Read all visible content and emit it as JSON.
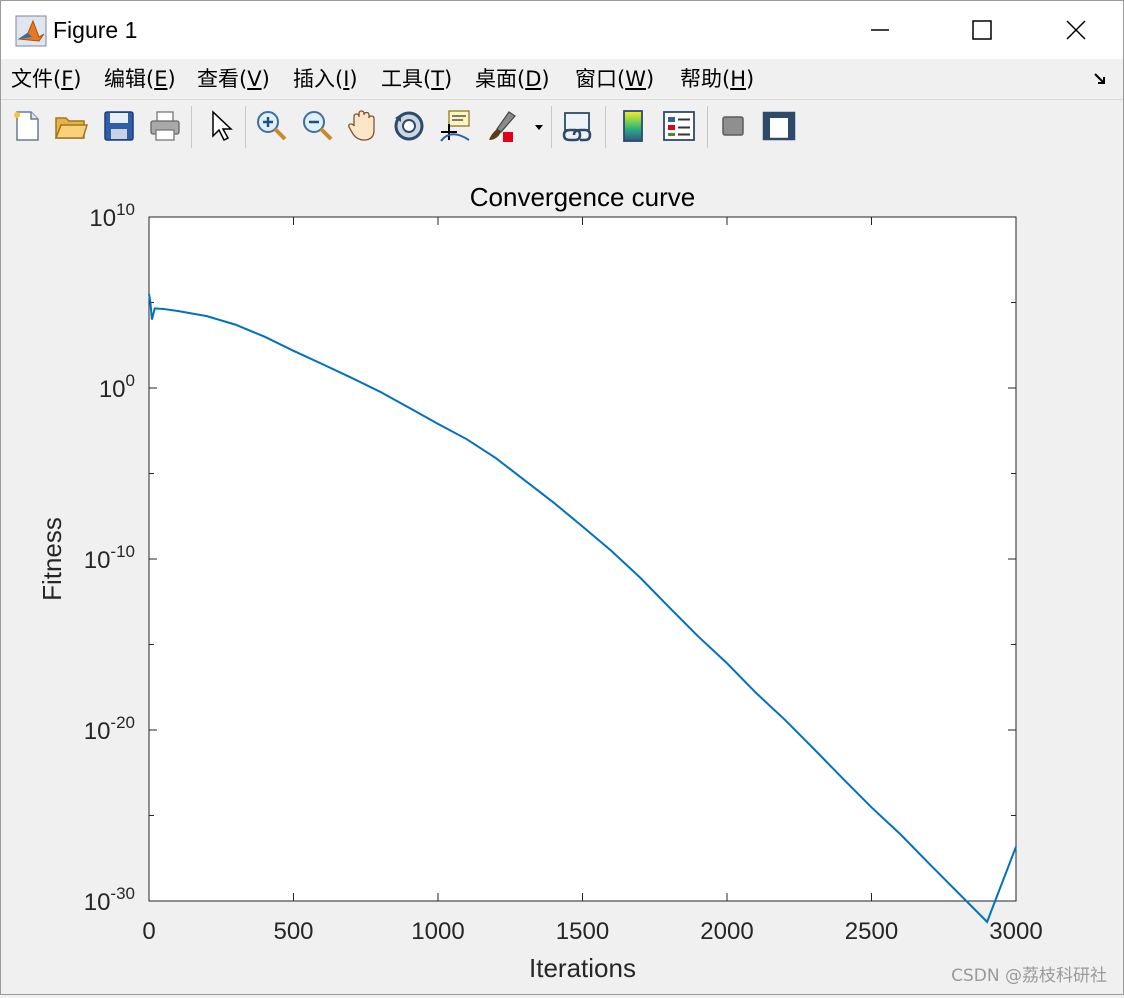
{
  "window": {
    "title": "Figure 1"
  },
  "menu": {
    "items": [
      {
        "label_pre": "文件(",
        "key": "F",
        "label_post": ")"
      },
      {
        "label_pre": "编辑(",
        "key": "E",
        "label_post": ")"
      },
      {
        "label_pre": "查看(",
        "key": "V",
        "label_post": ")"
      },
      {
        "label_pre": "插入(",
        "key": "I",
        "label_post": ")"
      },
      {
        "label_pre": "工具(",
        "key": "T",
        "label_post": ")"
      },
      {
        "label_pre": "桌面(",
        "key": "D",
        "label_post": ")"
      },
      {
        "label_pre": "窗口(",
        "key": "W",
        "label_post": ")"
      },
      {
        "label_pre": "帮助(",
        "key": "H",
        "label_post": ")"
      }
    ]
  },
  "toolbar": {
    "icons": [
      "new-figure-icon",
      "open-file-icon",
      "save-icon",
      "print-icon",
      "select-arrow-icon",
      "zoom-in-icon",
      "zoom-out-icon",
      "pan-hand-icon",
      "rotate-3d-icon",
      "data-cursor-icon",
      "brush-icon",
      "link-plot-icon",
      "colorbar-icon",
      "legend-icon",
      "hide-plot-tools-icon",
      "show-plot-tools-icon"
    ]
  },
  "chart_data": {
    "type": "line",
    "title": "Convergence curve",
    "xlabel": "Iterations",
    "ylabel": "Fitness",
    "xlim": [
      0,
      3000
    ],
    "ylim": [
      1e-30,
      10000000000.0
    ],
    "yscale": "log",
    "xticks": [
      "0",
      "500",
      "1000",
      "1500",
      "2000",
      "2500",
      "3000"
    ],
    "yticks": [
      {
        "base": "10",
        "exp": "10"
      },
      {
        "base": "10",
        "exp": "0"
      },
      {
        "base": "10",
        "exp": "-10"
      },
      {
        "base": "10",
        "exp": "-20"
      },
      {
        "base": "10",
        "exp": "-30"
      }
    ],
    "grid": false,
    "color": "#0072bd",
    "series": [
      {
        "x": [
          0,
          5,
          10,
          20,
          50,
          100,
          200,
          300,
          400,
          500,
          600,
          700,
          800,
          900,
          1000,
          1100,
          1200,
          1300,
          1400,
          1500,
          1600,
          1700,
          1800,
          1900,
          2000,
          2100,
          2200,
          2300,
          2400,
          2500,
          2600,
          2700,
          2800,
          2900,
          3000
        ],
        "y": [
          320000.0,
          100000.0,
          10000.0,
          45000.0,
          42000.0,
          32000.0,
          16000.0,
          5000.0,
          1000.0,
          150.0,
          25.0,
          4,
          0.6,
          0.07,
          0.008,
          0.001,
          8e-05,
          4e-06,
          2e-07,
          8e-09,
          3e-10,
          8e-12,
          1.5e-13,
          3e-15,
          8e-17,
          1.5e-18,
          4e-20,
          8e-22,
          1.5e-23,
          3e-25,
          8e-27,
          1.5e-28,
          3e-30,
          6e-32,
          1.5e-27
        ]
      }
    ]
  },
  "watermark": "CSDN @荔枝科研社"
}
